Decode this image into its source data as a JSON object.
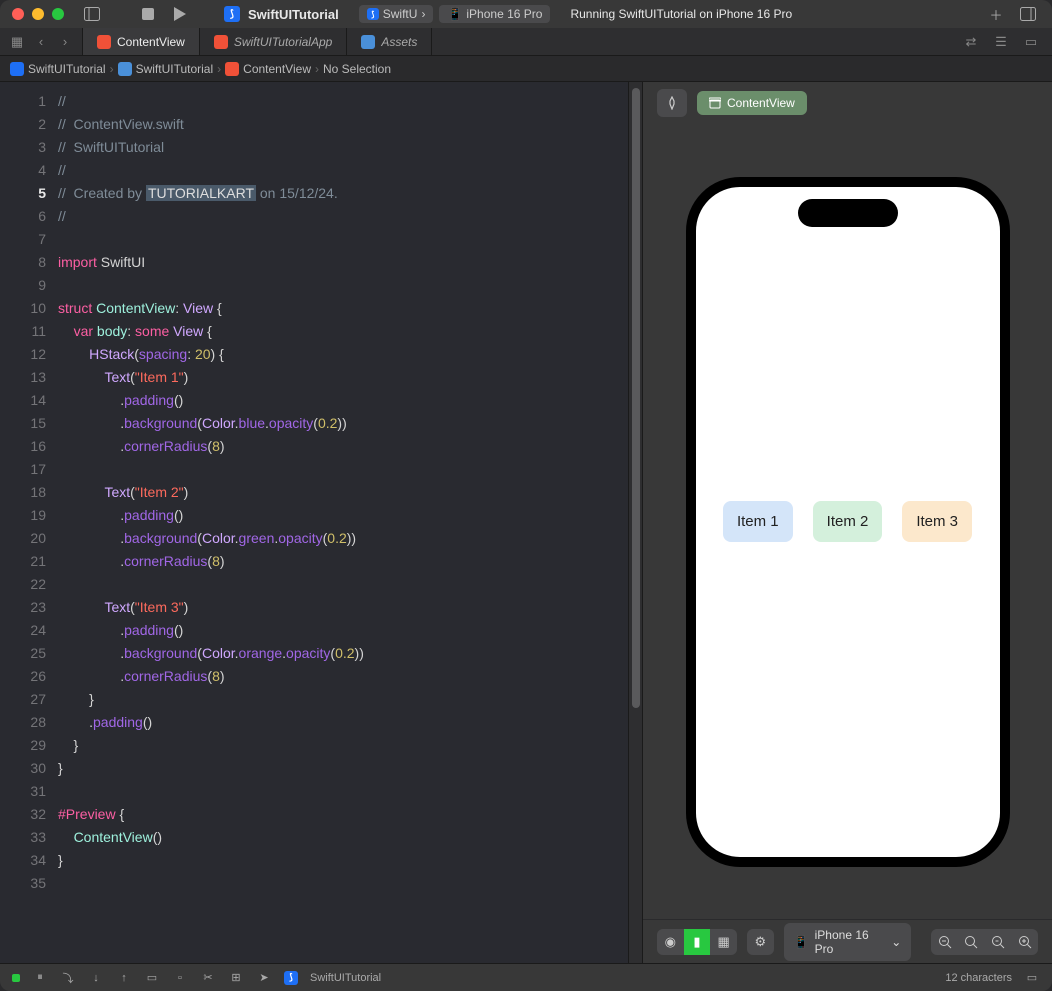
{
  "titlebar": {
    "project": "SwiftUITutorial",
    "scheme": "SwiftU",
    "device": "iPhone 16 Pro",
    "status": "Running SwiftUITutorial on iPhone 16 Pro"
  },
  "tabs": [
    {
      "label": "ContentView",
      "icon": "swift",
      "active": true
    },
    {
      "label": "SwiftUITutorialApp",
      "icon": "swift",
      "active": false
    },
    {
      "label": "Assets",
      "icon": "asset",
      "active": false
    }
  ],
  "breadcrumb": {
    "items": [
      "SwiftUITutorial",
      "SwiftUITutorial",
      "ContentView",
      "No Selection"
    ]
  },
  "code": {
    "current_line": 5,
    "lines": [
      {
        "n": 1,
        "seg": [
          {
            "c": "comment",
            "t": "//"
          }
        ]
      },
      {
        "n": 2,
        "seg": [
          {
            "c": "comment",
            "t": "//  ContentView.swift"
          }
        ]
      },
      {
        "n": 3,
        "seg": [
          {
            "c": "comment",
            "t": "//  SwiftUITutorial"
          }
        ]
      },
      {
        "n": 4,
        "seg": [
          {
            "c": "comment",
            "t": "//"
          }
        ]
      },
      {
        "n": 5,
        "seg": [
          {
            "c": "comment",
            "t": "//  Created by "
          },
          {
            "c": "hl",
            "t": "TUTORIALKART"
          },
          {
            "c": "comment",
            "t": " on 15/12/24."
          }
        ]
      },
      {
        "n": 6,
        "seg": [
          {
            "c": "comment",
            "t": "//"
          }
        ]
      },
      {
        "n": 7,
        "seg": [
          {
            "c": "text",
            "t": ""
          }
        ]
      },
      {
        "n": 8,
        "seg": [
          {
            "c": "kw",
            "t": "import"
          },
          {
            "c": "text",
            "t": " SwiftUI"
          }
        ]
      },
      {
        "n": 9,
        "seg": [
          {
            "c": "text",
            "t": ""
          }
        ]
      },
      {
        "n": 10,
        "seg": [
          {
            "c": "kw",
            "t": "struct"
          },
          {
            "c": "text",
            "t": " "
          },
          {
            "c": "type",
            "t": "ContentView"
          },
          {
            "c": "text",
            "t": ": "
          },
          {
            "c": "type2",
            "t": "View"
          },
          {
            "c": "text",
            "t": " {"
          }
        ]
      },
      {
        "n": 11,
        "seg": [
          {
            "c": "text",
            "t": "    "
          },
          {
            "c": "kw",
            "t": "var"
          },
          {
            "c": "text",
            "t": " "
          },
          {
            "c": "type",
            "t": "body"
          },
          {
            "c": "text",
            "t": ": "
          },
          {
            "c": "kw",
            "t": "some"
          },
          {
            "c": "text",
            "t": " "
          },
          {
            "c": "type2",
            "t": "View"
          },
          {
            "c": "text",
            "t": " {"
          }
        ]
      },
      {
        "n": 12,
        "seg": [
          {
            "c": "text",
            "t": "        "
          },
          {
            "c": "type2",
            "t": "HStack"
          },
          {
            "c": "text",
            "t": "("
          },
          {
            "c": "func",
            "t": "spacing"
          },
          {
            "c": "text",
            "t": ": "
          },
          {
            "c": "num",
            "t": "20"
          },
          {
            "c": "text",
            "t": ") {"
          }
        ]
      },
      {
        "n": 13,
        "seg": [
          {
            "c": "text",
            "t": "            "
          },
          {
            "c": "type2",
            "t": "Text"
          },
          {
            "c": "text",
            "t": "("
          },
          {
            "c": "str",
            "t": "\"Item 1\""
          },
          {
            "c": "text",
            "t": ")"
          }
        ]
      },
      {
        "n": 14,
        "seg": [
          {
            "c": "text",
            "t": "                ."
          },
          {
            "c": "func",
            "t": "padding"
          },
          {
            "c": "text",
            "t": "()"
          }
        ]
      },
      {
        "n": 15,
        "seg": [
          {
            "c": "text",
            "t": "                ."
          },
          {
            "c": "func",
            "t": "background"
          },
          {
            "c": "text",
            "t": "("
          },
          {
            "c": "type2",
            "t": "Color"
          },
          {
            "c": "text",
            "t": "."
          },
          {
            "c": "func",
            "t": "blue"
          },
          {
            "c": "text",
            "t": "."
          },
          {
            "c": "func",
            "t": "opacity"
          },
          {
            "c": "text",
            "t": "("
          },
          {
            "c": "num",
            "t": "0.2"
          },
          {
            "c": "text",
            "t": "))"
          }
        ]
      },
      {
        "n": 16,
        "seg": [
          {
            "c": "text",
            "t": "                ."
          },
          {
            "c": "func",
            "t": "cornerRadius"
          },
          {
            "c": "text",
            "t": "("
          },
          {
            "c": "num",
            "t": "8"
          },
          {
            "c": "text",
            "t": ")"
          }
        ]
      },
      {
        "n": 17,
        "seg": [
          {
            "c": "text",
            "t": ""
          }
        ]
      },
      {
        "n": 18,
        "seg": [
          {
            "c": "text",
            "t": "            "
          },
          {
            "c": "type2",
            "t": "Text"
          },
          {
            "c": "text",
            "t": "("
          },
          {
            "c": "str",
            "t": "\"Item 2\""
          },
          {
            "c": "text",
            "t": ")"
          }
        ]
      },
      {
        "n": 19,
        "seg": [
          {
            "c": "text",
            "t": "                ."
          },
          {
            "c": "func",
            "t": "padding"
          },
          {
            "c": "text",
            "t": "()"
          }
        ]
      },
      {
        "n": 20,
        "seg": [
          {
            "c": "text",
            "t": "                ."
          },
          {
            "c": "func",
            "t": "background"
          },
          {
            "c": "text",
            "t": "("
          },
          {
            "c": "type2",
            "t": "Color"
          },
          {
            "c": "text",
            "t": "."
          },
          {
            "c": "func",
            "t": "green"
          },
          {
            "c": "text",
            "t": "."
          },
          {
            "c": "func",
            "t": "opacity"
          },
          {
            "c": "text",
            "t": "("
          },
          {
            "c": "num",
            "t": "0.2"
          },
          {
            "c": "text",
            "t": "))"
          }
        ]
      },
      {
        "n": 21,
        "seg": [
          {
            "c": "text",
            "t": "                ."
          },
          {
            "c": "func",
            "t": "cornerRadius"
          },
          {
            "c": "text",
            "t": "("
          },
          {
            "c": "num",
            "t": "8"
          },
          {
            "c": "text",
            "t": ")"
          }
        ]
      },
      {
        "n": 22,
        "seg": [
          {
            "c": "text",
            "t": ""
          }
        ]
      },
      {
        "n": 23,
        "seg": [
          {
            "c": "text",
            "t": "            "
          },
          {
            "c": "type2",
            "t": "Text"
          },
          {
            "c": "text",
            "t": "("
          },
          {
            "c": "str",
            "t": "\"Item 3\""
          },
          {
            "c": "text",
            "t": ")"
          }
        ]
      },
      {
        "n": 24,
        "seg": [
          {
            "c": "text",
            "t": "                ."
          },
          {
            "c": "func",
            "t": "padding"
          },
          {
            "c": "text",
            "t": "()"
          }
        ]
      },
      {
        "n": 25,
        "seg": [
          {
            "c": "text",
            "t": "                ."
          },
          {
            "c": "func",
            "t": "background"
          },
          {
            "c": "text",
            "t": "("
          },
          {
            "c": "type2",
            "t": "Color"
          },
          {
            "c": "text",
            "t": "."
          },
          {
            "c": "func",
            "t": "orange"
          },
          {
            "c": "text",
            "t": "."
          },
          {
            "c": "func",
            "t": "opacity"
          },
          {
            "c": "text",
            "t": "("
          },
          {
            "c": "num",
            "t": "0.2"
          },
          {
            "c": "text",
            "t": "))"
          }
        ]
      },
      {
        "n": 26,
        "seg": [
          {
            "c": "text",
            "t": "                ."
          },
          {
            "c": "func",
            "t": "cornerRadius"
          },
          {
            "c": "text",
            "t": "("
          },
          {
            "c": "num",
            "t": "8"
          },
          {
            "c": "text",
            "t": ")"
          }
        ]
      },
      {
        "n": 27,
        "seg": [
          {
            "c": "text",
            "t": "        }"
          }
        ]
      },
      {
        "n": 28,
        "seg": [
          {
            "c": "text",
            "t": "        ."
          },
          {
            "c": "func",
            "t": "padding"
          },
          {
            "c": "text",
            "t": "()"
          }
        ]
      },
      {
        "n": 29,
        "seg": [
          {
            "c": "text",
            "t": "    }"
          }
        ]
      },
      {
        "n": 30,
        "seg": [
          {
            "c": "text",
            "t": "}"
          }
        ]
      },
      {
        "n": 31,
        "seg": [
          {
            "c": "text",
            "t": ""
          }
        ]
      },
      {
        "n": 32,
        "seg": [
          {
            "c": "kw",
            "t": "#Preview"
          },
          {
            "c": "text",
            "t": " {"
          }
        ]
      },
      {
        "n": 33,
        "seg": [
          {
            "c": "text",
            "t": "    "
          },
          {
            "c": "type",
            "t": "ContentView"
          },
          {
            "c": "text",
            "t": "()"
          }
        ]
      },
      {
        "n": 34,
        "seg": [
          {
            "c": "text",
            "t": "}"
          }
        ]
      },
      {
        "n": 35,
        "seg": [
          {
            "c": "text",
            "t": ""
          }
        ]
      }
    ]
  },
  "preview": {
    "chip": "ContentView",
    "items": [
      "Item 1",
      "Item 2",
      "Item 3"
    ],
    "device": "iPhone 16 Pro"
  },
  "statusbar": {
    "project": "SwiftUITutorial",
    "chars": "12 characters"
  }
}
